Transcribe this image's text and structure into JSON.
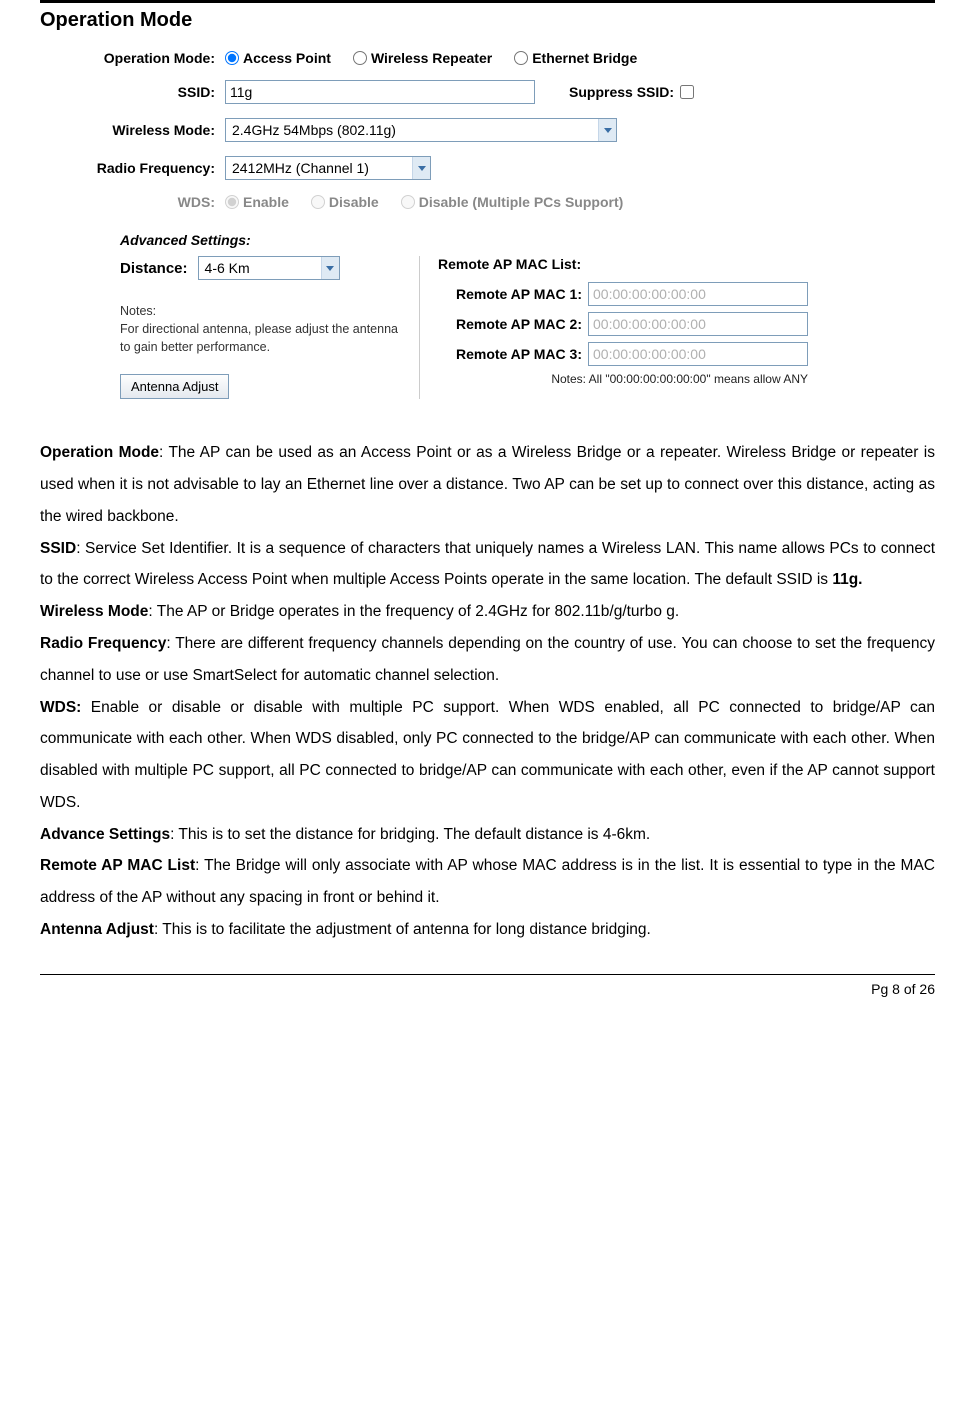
{
  "title": "Operation Mode",
  "form": {
    "operation_mode": {
      "label": "Operation Mode:",
      "options": [
        "Access Point",
        "Wireless Repeater",
        "Ethernet Bridge"
      ],
      "selected": "Access Point"
    },
    "ssid": {
      "label": "SSID:",
      "value": "11g",
      "suppress_label": "Suppress SSID:"
    },
    "wireless_mode": {
      "label": "Wireless Mode:",
      "value": "2.4GHz 54Mbps (802.11g)"
    },
    "radio_frequency": {
      "label": "Radio Frequency:",
      "value": "2412MHz (Channel 1)"
    },
    "wds": {
      "label": "WDS:",
      "options": [
        "Enable",
        "Disable",
        "Disable (Multiple PCs Support)"
      ],
      "selected": "Enable"
    }
  },
  "advanced": {
    "header": "Advanced Settings:",
    "distance_label": "Distance:",
    "distance_value": "4-6 Km",
    "notes_label": "Notes:",
    "notes_text": "For directional antenna, please adjust the antenna to gain better performance.",
    "antenna_button": "Antenna Adjust",
    "remote_list_label": "Remote AP MAC List:",
    "mac1_label": "Remote AP MAC 1:",
    "mac2_label": "Remote AP MAC 2:",
    "mac3_label": "Remote AP MAC 3:",
    "mac_value": "00:00:00:00:00:00",
    "mac_note": "Notes: All \"00:00:00:00:00:00\" means allow ANY"
  },
  "descriptions": {
    "p1_strong": "Operation Mode",
    "p1_text": ": The AP can be used as an Access Point or as a Wireless Bridge or a repeater. Wireless Bridge or repeater is used when it is not advisable to lay an Ethernet line over a distance. Two AP can be set up to connect over this distance, acting as the wired backbone.",
    "p2_strong": "SSID",
    "p2_text": ": Service Set Identifier. It is a sequence of characters that uniquely names a Wireless LAN. This name allows PCs to connect to the correct Wireless Access Point when multiple Access Points operate in the same location. The default SSID is ",
    "p2_strong2": "11g.",
    "p3_strong": "Wireless Mode",
    "p3_text": ": The AP or Bridge operates in the frequency of 2.4GHz for 802.11b/g/turbo g.",
    "p4_strong": "Radio Frequency",
    "p4_text": ": There are different frequency channels depending on the country of use. You can choose to set the frequency channel to use or use SmartSelect for automatic channel selection.",
    "p5_strong": "WDS:",
    "p5_text": " Enable or disable or disable with multiple PC support. When WDS enabled, all PC connected to bridge/AP can communicate with each other. When WDS disabled, only PC connected to the bridge/AP can communicate with each other. When disabled with multiple PC support, all PC connected to bridge/AP can communicate with each other, even if the AP cannot support WDS.",
    "p6_strong": "Advance Settings",
    "p6_text": ": This is to set the distance for bridging. The default distance is 4-6km.",
    "p7_strong": "Remote AP MAC List",
    "p7_text": ": The Bridge will only associate with AP whose MAC address is in the list. It is essential to type in the MAC address of the AP without any spacing in front or behind it.",
    "p8_strong": "Antenna Adjust",
    "p8_text": ": This is to facilitate the adjustment of antenna for long distance bridging."
  },
  "footer": "Pg 8 of 26"
}
